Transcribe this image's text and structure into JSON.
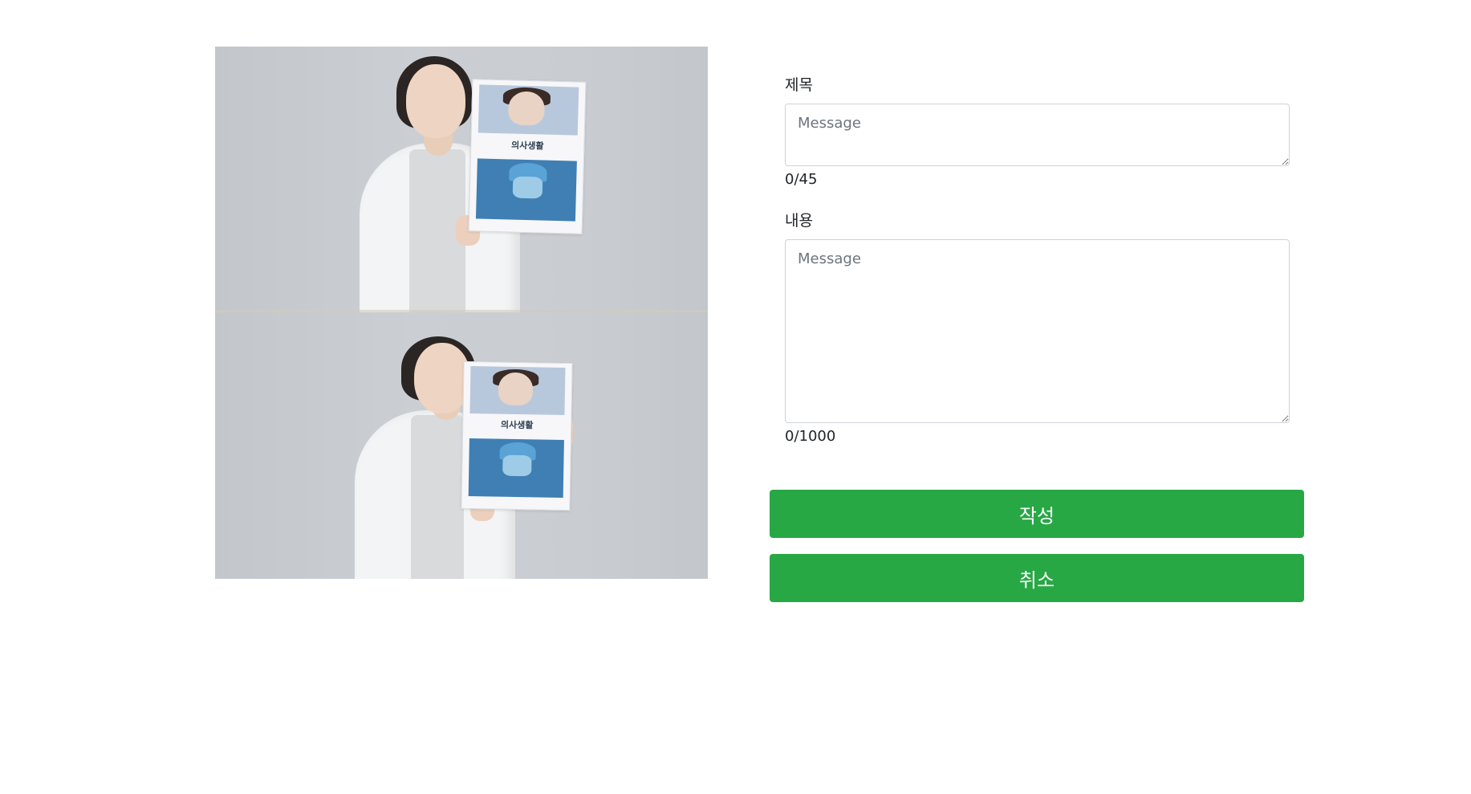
{
  "photos": [
    {
      "name": "photo-1",
      "poster_text": "의사생활"
    },
    {
      "name": "photo-2",
      "poster_text": "의사생활"
    }
  ],
  "form": {
    "title_label": "제목",
    "title_placeholder": "Message",
    "title_value": "",
    "title_counter": "0/45",
    "content_label": "내용",
    "content_placeholder": "Message",
    "content_value": "",
    "content_counter": "0/1000"
  },
  "buttons": {
    "submit_label": "작성",
    "cancel_label": "취소"
  },
  "colors": {
    "button_bg": "#28a745",
    "button_text": "#ffffff",
    "input_border": "#ced4da",
    "placeholder": "#6c757d"
  }
}
